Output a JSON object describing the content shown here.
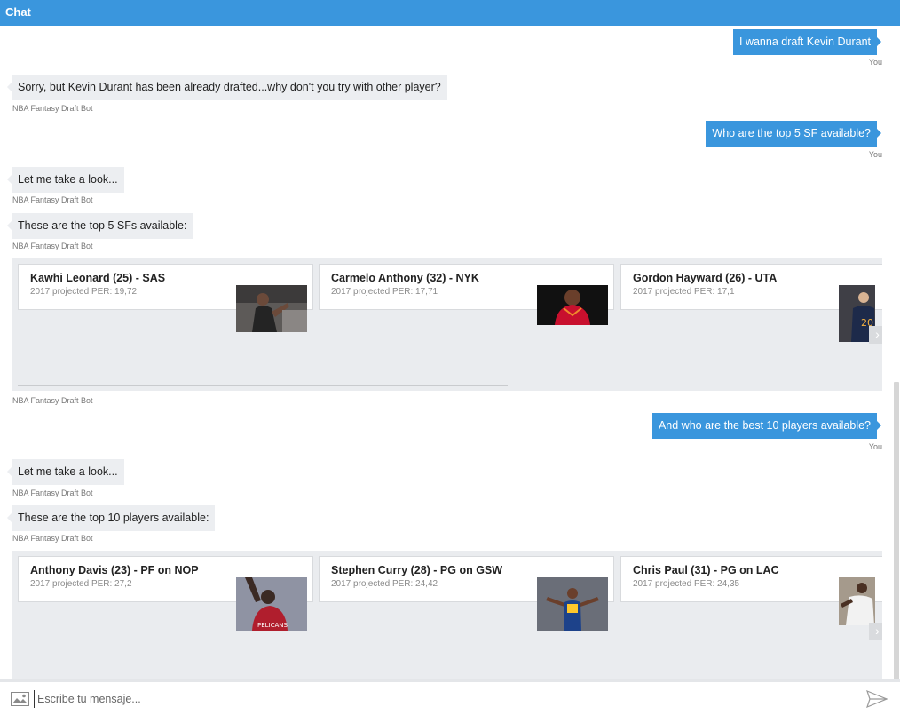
{
  "window": {
    "title": "Chat"
  },
  "messages": [
    {
      "text": "I wanna draft Kevin Durant",
      "from": "You"
    },
    {
      "text": "Sorry, but Kevin Durant has been already drafted...why don't you try with other player?",
      "from": "NBA Fantasy Draft Bot"
    },
    {
      "text": "Who are the top 5 SF available?",
      "from": "You"
    },
    {
      "text": "Let me take a look...",
      "from": "NBA Fantasy Draft Bot"
    },
    {
      "text": "These are the top 5 SFs available:",
      "from": "NBA Fantasy Draft Bot"
    },
    {
      "from": "NBA Fantasy Draft Bot"
    },
    {
      "text": "And who are the best 10 players available?",
      "from": "You"
    },
    {
      "text": "Let me take a look...",
      "from": "NBA Fantasy Draft Bot"
    },
    {
      "text": "These are the top 10 players available:",
      "from": "NBA Fantasy Draft Bot"
    }
  ],
  "carousels": [
    {
      "cards": [
        {
          "title": "Kawhi Leonard (25) - SAS",
          "subtitle": "2017 projected PER: 19,72",
          "jersey_color": "#2b2b2b"
        },
        {
          "title": "Carmelo Anthony (32) - NYK",
          "subtitle": "2017 projected PER: 17,71",
          "jersey_color": "#c8102e"
        },
        {
          "title": "Gordon Hayward (26) - UTA",
          "subtitle": "2017 projected PER: 17,1",
          "jersey_color": "#1d2a4a"
        }
      ],
      "next_icon": "chevron-right-icon"
    },
    {
      "cards": [
        {
          "title": "Anthony Davis (23) - PF on NOP",
          "subtitle": "2017 projected PER: 27,2",
          "jersey_color": "#b01e2d"
        },
        {
          "title": "Stephen Curry (28) - PG on GSW",
          "subtitle": "2017 projected PER: 24,42",
          "jersey_color": "#1d428a"
        },
        {
          "title": "Chris Paul (31) - PG on LAC",
          "subtitle": "2017 projected PER: 24,35",
          "jersey_color": "#f1f1f1"
        }
      ],
      "next_icon": "chevron-right-icon"
    }
  ],
  "composer": {
    "placeholder": "Escribe tu mensaje...",
    "image_icon": "image-icon",
    "send_icon": "send-icon"
  },
  "colors": {
    "accent": "#3a96dd",
    "bot_bubble": "#eceef1",
    "carousel_bg": "#eaecef"
  }
}
